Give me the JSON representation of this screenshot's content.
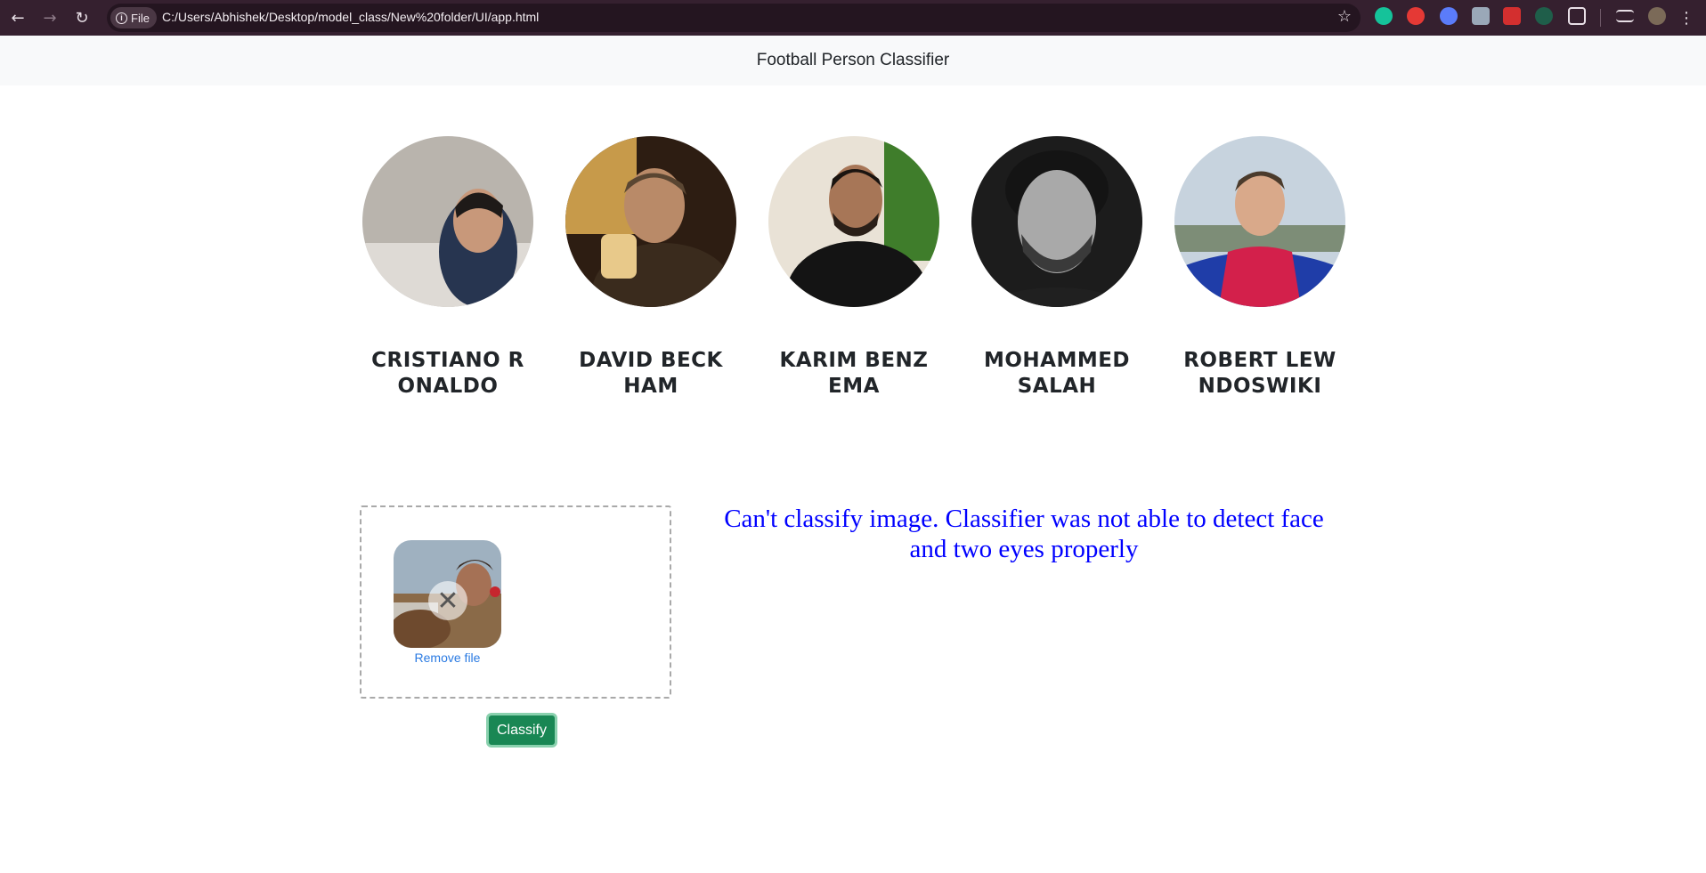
{
  "browser": {
    "back_icon": "arrow-left-icon",
    "forward_icon": "arrow-right-icon",
    "reload_icon": "reload-icon",
    "file_chip_label": "File",
    "url": "C:/Users/Abhishek/Desktop/model_class/New%20folder/UI/app.html",
    "bookmark_icon": "star-icon"
  },
  "navbar": {
    "title": "Football Person Classifier"
  },
  "players": [
    {
      "name": "CRISTIANO RONALDO"
    },
    {
      "name": "DAVID BECKHAM"
    },
    {
      "name": "KARIM BENZEMA"
    },
    {
      "name": "MOHAMMED SALAH"
    },
    {
      "name": "ROBERT LEWNDOSWIKI"
    }
  ],
  "upload": {
    "remove_label": "Remove file",
    "remove_icon": "close-icon"
  },
  "classify_button": "Classify",
  "error_message": "Can't classify image. Classifier was not able to detect face and two eyes properly",
  "colors": {
    "chrome_bg": "#35202f",
    "navbar_bg": "#f8f9fa",
    "button_green": "#198754",
    "error_blue": "#0000ff",
    "link_blue": "#2a7ae2"
  }
}
